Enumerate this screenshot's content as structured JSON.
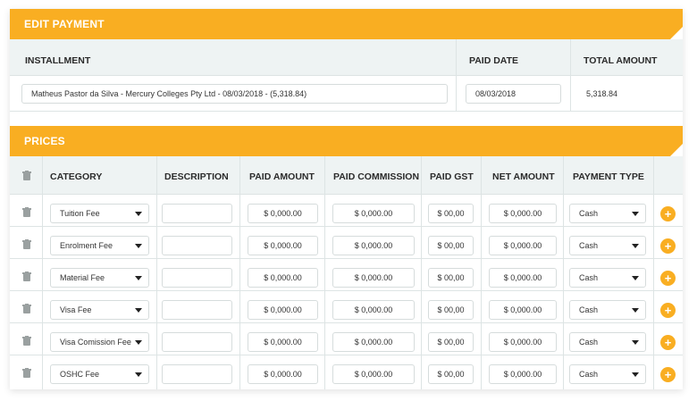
{
  "edit_payment": {
    "title": "EDIT PAYMENT",
    "headers": {
      "installment": "INSTALLMENT",
      "paid_date": "PAID DATE",
      "total_amount": "TOTAL AMOUNT"
    },
    "installment_value": "Matheus Pastor da Silva - Mercury Colleges Pty Ltd - 08/03/2018 - (5,318.84)",
    "paid_date_value": "08/03/2018",
    "total_amount_value": "5,318.84"
  },
  "prices": {
    "title": "PRICES",
    "headers": {
      "category": "CATEGORY",
      "description": "DESCRIPTION",
      "paid_amount": "PAID AMOUNT",
      "paid_commission": "PAID COMMISSION",
      "paid_gst": "PAID GST",
      "net_amount": "NET AMOUNT",
      "payment_type": "PAYMENT TYPE"
    },
    "rows": [
      {
        "category": "Tuition Fee",
        "description": "",
        "paid_amount": "$ 0,000.00",
        "paid_commission": "$ 0,000.00",
        "paid_gst": "$ 00,00",
        "net_amount": "$ 0,000.00",
        "payment_type": "Cash"
      },
      {
        "category": "Enrolment Fee",
        "description": "",
        "paid_amount": "$ 0,000.00",
        "paid_commission": "$ 0,000.00",
        "paid_gst": "$ 00,00",
        "net_amount": "$ 0,000.00",
        "payment_type": "Cash"
      },
      {
        "category": "Material Fee",
        "description": "",
        "paid_amount": "$ 0,000.00",
        "paid_commission": "$ 0,000.00",
        "paid_gst": "$ 00,00",
        "net_amount": "$ 0,000.00",
        "payment_type": "Cash"
      },
      {
        "category": "Visa Fee",
        "description": "",
        "paid_amount": "$ 0,000.00",
        "paid_commission": "$ 0,000.00",
        "paid_gst": "$ 00,00",
        "net_amount": "$ 0,000.00",
        "payment_type": "Cash"
      },
      {
        "category": "Visa Comission Fee",
        "description": "",
        "paid_amount": "$ 0,000.00",
        "paid_commission": "$ 0,000.00",
        "paid_gst": "$ 00,00",
        "net_amount": "$ 0,000.00",
        "payment_type": "Cash"
      },
      {
        "category": "OSHC Fee",
        "description": "",
        "paid_amount": "$ 0,000.00",
        "paid_commission": "$ 0,000.00",
        "paid_gst": "$ 00,00",
        "net_amount": "$ 0,000.00",
        "payment_type": "Cash"
      }
    ],
    "add_label": "+",
    "icons": {
      "delete": "trash-icon",
      "add": "plus-circle-icon",
      "dropdown": "chevron-down-icon"
    }
  },
  "colors": {
    "accent": "#f9ae22",
    "band": "#eef3f3",
    "icon_gray": "#9aa0a0"
  }
}
